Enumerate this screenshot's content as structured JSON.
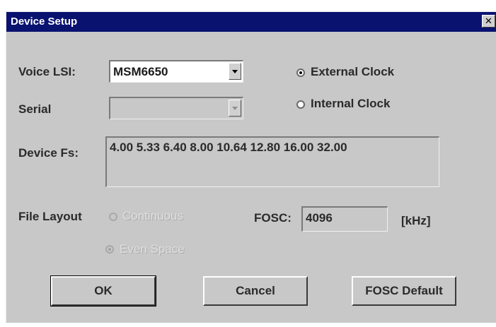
{
  "window": {
    "title": "Device Setup",
    "close_glyph": "✕"
  },
  "voice_lsi": {
    "label": "Voice LSI:",
    "value": "MSM6650"
  },
  "serial": {
    "label": "Serial",
    "value": ""
  },
  "clock": {
    "external_label": "External Clock",
    "internal_label": "Internal  Clock",
    "selected": "external"
  },
  "device_fs": {
    "label": "Device Fs:",
    "value": "4.00 5.33 6.40 8.00 10.64 12.80 16.00 32.00"
  },
  "file_layout": {
    "label": "File Layout",
    "continuous_label": "Continuous",
    "even_space_label": "Even Space",
    "selected": "even_space"
  },
  "fosc": {
    "label": "FOSC:",
    "value": "4096",
    "unit": "[kHz]"
  },
  "buttons": {
    "ok": "OK",
    "cancel": "Cancel",
    "fosc_default": "FOSC Default"
  }
}
